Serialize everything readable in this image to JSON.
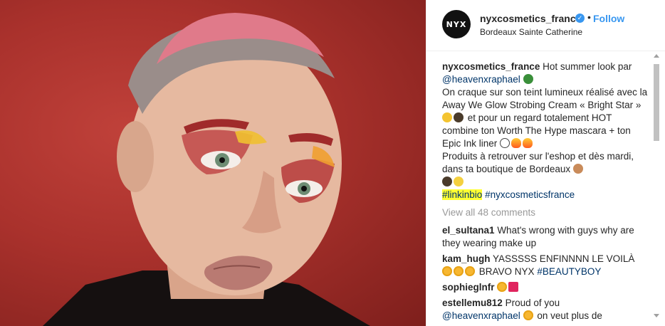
{
  "header": {
    "avatar_text": "NYX",
    "username": "nyxcosmetics_france",
    "verified_mark": "✓",
    "separator": "•",
    "follow_label": "Follow",
    "location": "Bordeaux Sainte Catherine"
  },
  "caption": {
    "username": "nyxcosmetics_france",
    "text_1": "Hot summer look par",
    "mention": "@heavenxraphael",
    "text_2": "On craque sur son teint lumineux réalisé avec la Away We Glow Strobing Cream « Bright Star »",
    "text_3": "et pour un regard totalement HOT combine ton Worth The Hype mascara + ton Epic Ink liner",
    "text_4": "Produits à retrouver sur l'eshop et dès mardi, dans ta boutique de Bordeaux",
    "hashtag_1": "#linkinbio",
    "hashtag_2": "#nyxcosmeticsfrance"
  },
  "view_all": "View all 48 comments",
  "comments": [
    {
      "user": "el_sultana1",
      "text": "What's wrong with guys why are they wearing make up"
    },
    {
      "user": "kam_hugh",
      "text": "YASSSSS ENFINNNN LE VOILÀ",
      "text_b": "BRAVO NYX",
      "tag": "#BEAUTYBOY"
    },
    {
      "user": "sophieglnfr",
      "text": ""
    },
    {
      "user": "estellemu812",
      "text": "Proud of you"
    }
  ],
  "last_line": {
    "mention": "@heavenxraphael",
    "text": "on veut plus de"
  },
  "colors": {
    "link": "#3897f0",
    "mention": "#003569",
    "highlight": "#ffff33",
    "photo_bg": "#a9312c"
  }
}
